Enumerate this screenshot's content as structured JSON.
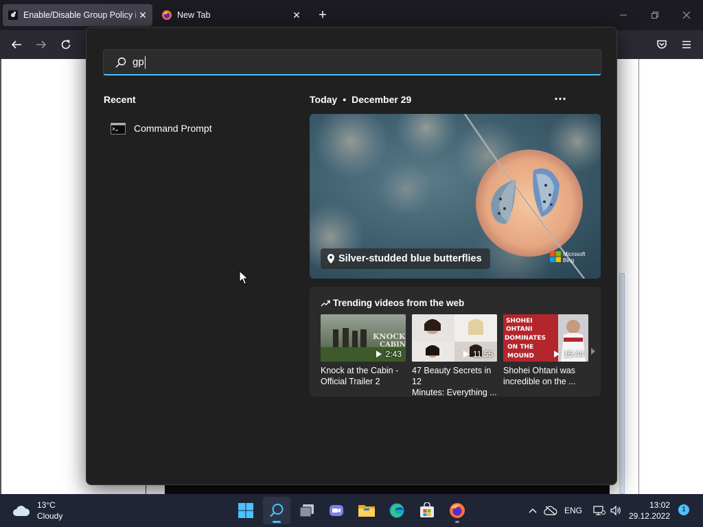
{
  "browser": {
    "tabs": [
      {
        "title": "Enable/Disable Group Policy in",
        "active": true
      },
      {
        "title": "New Tab",
        "active": false
      }
    ],
    "new_tab_label": "+"
  },
  "search": {
    "query": "gp",
    "recent_heading": "Recent",
    "recent_items": [
      {
        "label": "Command Prompt",
        "icon": "command-prompt-icon"
      }
    ],
    "today_label": "Today",
    "date_label": "December 29",
    "hero": {
      "caption": "Silver-studded blue butterflies",
      "brand": "Microsoft Bing"
    },
    "trending": {
      "title": "Trending videos from the web",
      "videos": [
        {
          "title": "Knock at the Cabin -\nOfficial Trailer 2",
          "duration": "2:43",
          "thumb_text": "KNOCK\nCABIN"
        },
        {
          "title": "47 Beauty Secrets in 12\nMinutes: Everything ...",
          "duration": "11:55"
        },
        {
          "title": "Shohei Ohtani was\nincredible on the ...",
          "duration": "15:44",
          "thumb_text": "SHOHEI\nOHTANI\nDOMINATES\nON THE\nMOUND"
        }
      ]
    }
  },
  "taskbar": {
    "weather": {
      "temp": "13°C",
      "condition": "Cloudy"
    },
    "language": "ENG",
    "time": "13:02",
    "date": "29.12.2022",
    "notification_count": "1"
  },
  "colors": {
    "accent": "#4cc2ff",
    "flyout_bg": "#202020",
    "taskbar_bg": "#1f2535",
    "browser_chrome": "#1c1b22"
  }
}
